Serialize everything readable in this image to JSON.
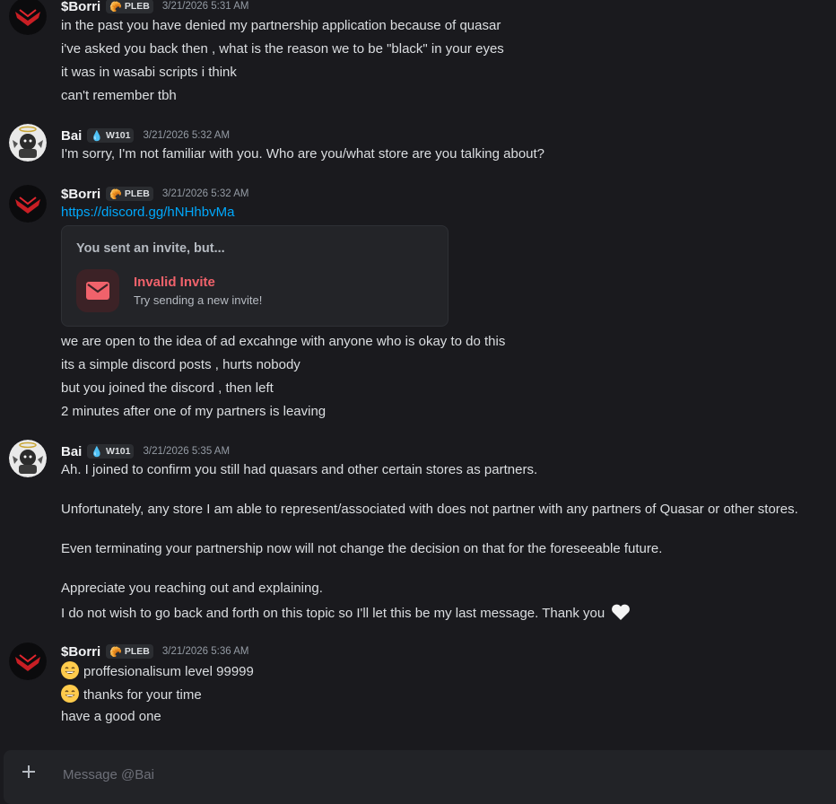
{
  "messages": [
    {
      "author": "$Borri",
      "tag": "PLEB",
      "time": "3/21/2026 5:31 AM",
      "lines": [
        "in the past you have denied my partnership application because of quasar",
        "i've asked you back then , what is the reason we to be \"black\" in your eyes",
        "it was in wasabi scripts i think",
        "can't remember tbh"
      ]
    },
    {
      "author": "Bai",
      "tag": "W101",
      "time": "3/21/2026 5:32 AM",
      "lines": [
        "I'm sorry, I'm not familiar with you. Who are you/what store are you talking about?"
      ]
    },
    {
      "author": "$Borri",
      "tag": "PLEB",
      "time": "3/21/2026 5:32 AM",
      "link": "https://discord.gg/hNHhbvMa",
      "invite": {
        "heading": "You sent an invite, but...",
        "title": "Invalid Invite",
        "subtitle": "Try sending a new invite!"
      },
      "lines": [
        "we are open to the idea of ad excahnge with anyone who is okay to do this",
        "its a simple discord posts , hurts nobody",
        "but you joined the discord , then left",
        "2 minutes after one of my partners is leaving"
      ]
    },
    {
      "author": "Bai",
      "tag": "W101",
      "time": "3/21/2026 5:35 AM",
      "lines": [
        "Ah. I joined to confirm you still had quasars and other certain stores as partners.",
        "Unfortunately, any store I am able to represent/associated with does not partner with any partners of Quasar or other stores.",
        "Even terminating your partnership now will not change the decision on that for the foreseeable future.",
        "Appreciate you reaching out and explaining.",
        "I do not wish to go back and forth on this topic so I'll let this be my last message. Thank you"
      ]
    },
    {
      "author": "$Borri",
      "tag": "PLEB",
      "time": "3/21/2026 5:36 AM",
      "lines": [
        "proffesionalisum level 99999",
        "thanks for your time",
        "have a good one"
      ]
    }
  ],
  "composer": {
    "placeholder": "Message @Bai"
  },
  "colors": {
    "background": "#1a1a1e",
    "link": "#00a8fc",
    "invalid": "#f0626b"
  }
}
